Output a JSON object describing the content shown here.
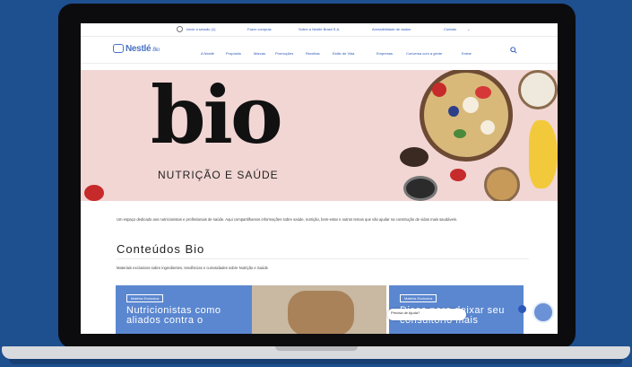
{
  "utility": {
    "links": [
      "Inicie a sessão (1)",
      "Fazer compras",
      "Sobre a Nestlé Brasil S.A.",
      "Acessibilidade de dados",
      "Contato"
    ]
  },
  "nav": {
    "logo": "Nestlé",
    "logo_sub": "Bio",
    "items": [
      "A Nestlé",
      "Propósito",
      "Marcas",
      "Promoções",
      "Receitas",
      "Estilo de Vida",
      "Empresas",
      "Conversa com a gente",
      "Entrar"
    ]
  },
  "hero": {
    "title": "bio",
    "subtitle": "NUTRIÇÃO E SAÚDE"
  },
  "content": {
    "intro": "Um espaço dedicado aos nutricionistas e profissionais de saúde. Aqui compartilhamos informações sobre saúde, nutrição, bem-estar e outros temas que vão ajudar na construção de vidas mais saudáveis.",
    "section_title": "Conteúdos Bio",
    "section_desc": "Materiais exclusivos sobre ingredientes, tendências e curiosidades sobre Nutrição e Saúde"
  },
  "cards": [
    {
      "badge": "Matéria Exclusiva",
      "title": "Nutricionistas como aliados contra o"
    },
    {
      "badge": "Matéria Exclusiva",
      "title": "Dicas para deixar seu consultório mais"
    }
  ],
  "help": {
    "text": "Precisa de Ajuda?"
  },
  "colors": {
    "background": "#1e4f8f",
    "hero_pink": "#f1d6d4",
    "card_blue": "#5b87d0",
    "brand_blue": "#2b58b9"
  }
}
